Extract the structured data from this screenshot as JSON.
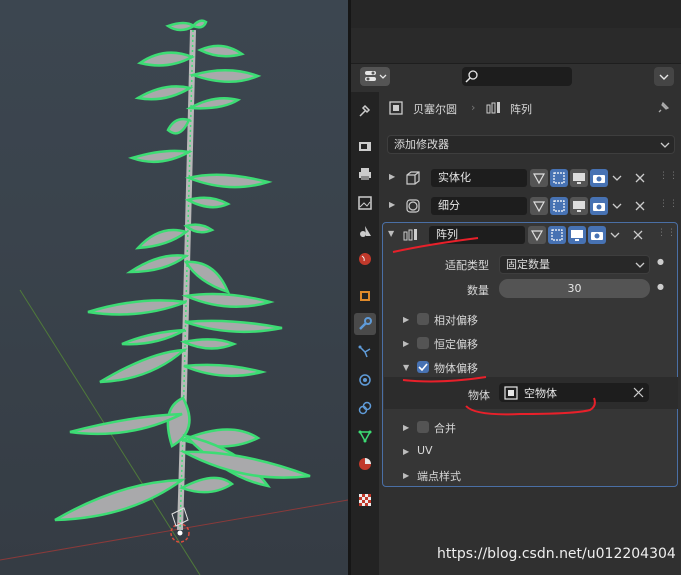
{
  "viewport": {
    "description": ""
  },
  "breadcrumb": {
    "object_name": "贝塞尔圆",
    "modifier_name": "阵列"
  },
  "add_modifier": {
    "label": "添加修改器"
  },
  "modifiers": [
    {
      "name": "实体化",
      "expanded": false
    },
    {
      "name": "细分",
      "expanded": false
    },
    {
      "name": "阵列",
      "expanded": true
    }
  ],
  "array": {
    "fit_type_label": "适配类型",
    "fit_type_value": "固定数量",
    "count_label": "数量",
    "count_value": "30",
    "relative_offset": {
      "label": "相对偏移",
      "checked": false
    },
    "constant_offset": {
      "label": "恒定偏移",
      "checked": false
    },
    "object_offset": {
      "label": "物体偏移",
      "checked": true
    },
    "object_label": "物体",
    "object_value": "空物体",
    "merge": {
      "label": "合并",
      "checked": false
    },
    "uv_label": "UV",
    "caps_label": "端点样式"
  },
  "watermark": "https://blog.csdn.net/u012204304",
  "colors": {
    "accent": "#4772b3",
    "outline_green": "#3ddc74",
    "annotation_red": "#e8202a"
  }
}
